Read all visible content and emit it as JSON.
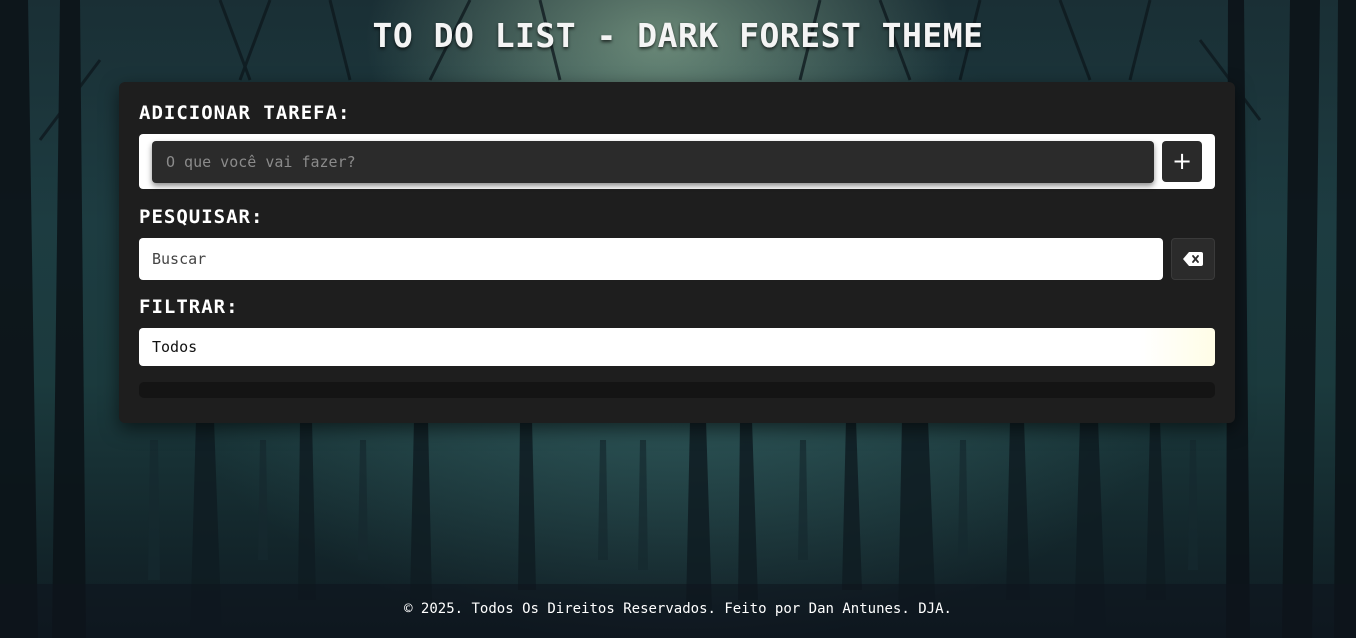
{
  "header": {
    "title": "TO DO LIST - DARK FOREST THEME"
  },
  "add_task": {
    "label": "ADICIONAR TAREFA:",
    "input_placeholder": "O que você vai fazer?",
    "add_button_label": "+"
  },
  "search": {
    "label": "PESQUISAR:",
    "input_placeholder": "Buscar",
    "clear_button_icon": "backspace-icon"
  },
  "filter": {
    "label": "FILTRAR:",
    "selected": "Todos"
  },
  "footer": {
    "text": "© 2025. Todos Os Direitos Reservados. Feito por Dan Antunes. DJA."
  },
  "colors": {
    "card_background": "#1e1e1e",
    "input_dark": "#2b2b2b",
    "text_light": "#ffffff"
  }
}
